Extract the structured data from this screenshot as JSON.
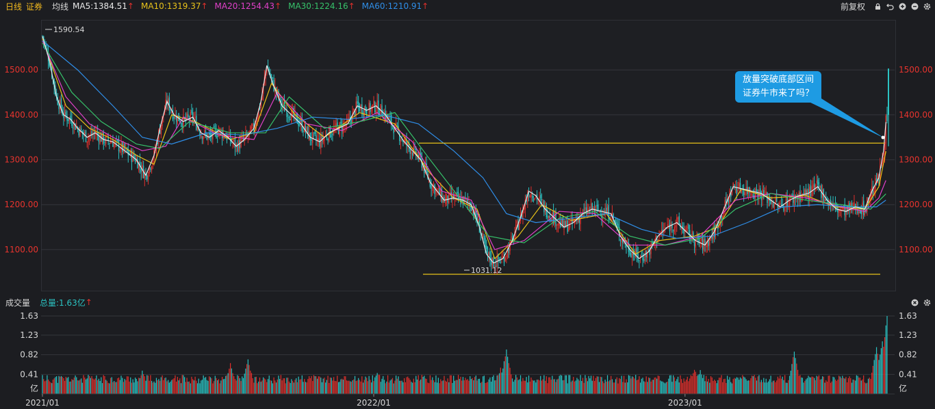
{
  "header": {
    "period": "日线",
    "name": "证券",
    "ma_label": "均线",
    "ma": [
      {
        "text": "MA5:1384.51",
        "color": "#e8e8e8"
      },
      {
        "text": "MA10:1319.37",
        "color": "#e8c21a"
      },
      {
        "text": "MA20:1254.43",
        "color": "#e040c8"
      },
      {
        "text": "MA30:1224.16",
        "color": "#36c26a"
      },
      {
        "text": "MA60:1210.91",
        "color": "#2f8ee8"
      }
    ],
    "adjust_label": "前复权",
    "up_arrow": "↑"
  },
  "callout": {
    "line1": "放量突破底部区间",
    "line2": "证券牛市来了吗？"
  },
  "volume_header": {
    "title": "成交量",
    "total": "总量:1.63亿"
  },
  "colors": {
    "up": "#e0302c",
    "down": "#2bc3c3",
    "label_red": "#e8342e",
    "support": "#e8c21a"
  },
  "chart_data": [
    {
      "type": "candlestick",
      "title": "证券",
      "y_ticks": [
        "1500.00",
        "1400.00",
        "1300.00",
        "1200.00",
        "1100.00"
      ],
      "ylim": [
        1010,
        1610
      ],
      "annotations": {
        "high": "1590.54",
        "low": "1031.12"
      },
      "support_lines": [
        1337,
        1045
      ],
      "close_path": [
        [
          0,
          1575
        ],
        [
          6,
          1520
        ],
        [
          12,
          1440
        ],
        [
          18,
          1400
        ],
        [
          24,
          1390
        ],
        [
          30,
          1370
        ],
        [
          38,
          1350
        ],
        [
          45,
          1360
        ],
        [
          52,
          1345
        ],
        [
          60,
          1340
        ],
        [
          70,
          1320
        ],
        [
          80,
          1300
        ],
        [
          88,
          1265
        ],
        [
          95,
          1310
        ],
        [
          100,
          1370
        ],
        [
          106,
          1430
        ],
        [
          112,
          1400
        ],
        [
          120,
          1385
        ],
        [
          128,
          1395
        ],
        [
          135,
          1360
        ],
        [
          142,
          1350
        ],
        [
          150,
          1365
        ],
        [
          158,
          1350
        ],
        [
          165,
          1330
        ],
        [
          172,
          1345
        ],
        [
          180,
          1370
        ],
        [
          186,
          1430
        ],
        [
          191,
          1510
        ],
        [
          196,
          1470
        ],
        [
          204,
          1420
        ],
        [
          212,
          1400
        ],
        [
          220,
          1380
        ],
        [
          228,
          1350
        ],
        [
          236,
          1340
        ],
        [
          244,
          1360
        ],
        [
          252,
          1370
        ],
        [
          260,
          1380
        ],
        [
          268,
          1420
        ],
        [
          276,
          1410
        ],
        [
          284,
          1420
        ],
        [
          292,
          1400
        ],
        [
          300,
          1370
        ],
        [
          308,
          1340
        ],
        [
          315,
          1320
        ],
        [
          322,
          1300
        ],
        [
          330,
          1250
        ],
        [
          336,
          1230
        ],
        [
          342,
          1210
        ],
        [
          350,
          1215
        ],
        [
          358,
          1210
        ],
        [
          365,
          1200
        ],
        [
          372,
          1150
        ],
        [
          378,
          1090
        ],
        [
          384,
          1070
        ],
        [
          392,
          1080
        ],
        [
          400,
          1120
        ],
        [
          408,
          1180
        ],
        [
          414,
          1230
        ],
        [
          420,
          1220
        ],
        [
          428,
          1190
        ],
        [
          436,
          1170
        ],
        [
          444,
          1150
        ],
        [
          452,
          1160
        ],
        [
          460,
          1180
        ],
        [
          468,
          1190
        ],
        [
          476,
          1185
        ],
        [
          484,
          1180
        ],
        [
          492,
          1130
        ],
        [
          500,
          1100
        ],
        [
          508,
          1080
        ],
        [
          516,
          1095
        ],
        [
          524,
          1130
        ],
        [
          532,
          1150
        ],
        [
          540,
          1160
        ],
        [
          548,
          1140
        ],
        [
          556,
          1120
        ],
        [
          564,
          1110
        ],
        [
          572,
          1140
        ],
        [
          580,
          1190
        ],
        [
          588,
          1240
        ],
        [
          596,
          1235
        ],
        [
          604,
          1230
        ],
        [
          612,
          1225
        ],
        [
          620,
          1210
        ],
        [
          628,
          1195
        ],
        [
          636,
          1210
        ],
        [
          644,
          1220
        ],
        [
          652,
          1225
        ],
        [
          660,
          1240
        ],
        [
          668,
          1210
        ],
        [
          676,
          1190
        ],
        [
          684,
          1185
        ],
        [
          692,
          1195
        ],
        [
          700,
          1190
        ],
        [
          706,
          1230
        ],
        [
          712,
          1260
        ],
        [
          716,
          1320
        ],
        [
          718,
          1384
        ]
      ],
      "ma_paths": {
        "ma10": [
          [
            0,
            1570
          ],
          [
            20,
            1420
          ],
          [
            40,
            1370
          ],
          [
            60,
            1345
          ],
          [
            80,
            1310
          ],
          [
            95,
            1290
          ],
          [
            110,
            1400
          ],
          [
            130,
            1385
          ],
          [
            160,
            1345
          ],
          [
            180,
            1360
          ],
          [
            195,
            1470
          ],
          [
            215,
            1400
          ],
          [
            240,
            1350
          ],
          [
            270,
            1405
          ],
          [
            300,
            1380
          ],
          [
            330,
            1270
          ],
          [
            350,
            1215
          ],
          [
            370,
            1190
          ],
          [
            385,
            1080
          ],
          [
            405,
            1130
          ],
          [
            425,
            1200
          ],
          [
            450,
            1165
          ],
          [
            480,
            1180
          ],
          [
            505,
            1090
          ],
          [
            525,
            1120
          ],
          [
            555,
            1130
          ],
          [
            575,
            1150
          ],
          [
            595,
            1235
          ],
          [
            620,
            1215
          ],
          [
            650,
            1220
          ],
          [
            675,
            1195
          ],
          [
            700,
            1190
          ],
          [
            712,
            1240
          ],
          [
            718,
            1319
          ]
        ],
        "ma20": [
          [
            0,
            1565
          ],
          [
            20,
            1440
          ],
          [
            40,
            1380
          ],
          [
            60,
            1350
          ],
          [
            85,
            1320
          ],
          [
            105,
            1330
          ],
          [
            120,
            1395
          ],
          [
            150,
            1355
          ],
          [
            180,
            1345
          ],
          [
            200,
            1450
          ],
          [
            225,
            1380
          ],
          [
            255,
            1365
          ],
          [
            285,
            1405
          ],
          [
            315,
            1340
          ],
          [
            340,
            1230
          ],
          [
            365,
            1210
          ],
          [
            385,
            1100
          ],
          [
            410,
            1120
          ],
          [
            440,
            1185
          ],
          [
            470,
            1180
          ],
          [
            500,
            1110
          ],
          [
            530,
            1110
          ],
          [
            560,
            1130
          ],
          [
            590,
            1210
          ],
          [
            620,
            1225
          ],
          [
            650,
            1215
          ],
          [
            680,
            1195
          ],
          [
            700,
            1185
          ],
          [
            712,
            1215
          ],
          [
            718,
            1254
          ]
        ],
        "ma30": [
          [
            0,
            1560
          ],
          [
            25,
            1450
          ],
          [
            50,
            1385
          ],
          [
            80,
            1335
          ],
          [
            100,
            1325
          ],
          [
            125,
            1385
          ],
          [
            160,
            1360
          ],
          [
            190,
            1360
          ],
          [
            210,
            1440
          ],
          [
            240,
            1370
          ],
          [
            270,
            1385
          ],
          [
            300,
            1405
          ],
          [
            330,
            1300
          ],
          [
            355,
            1215
          ],
          [
            380,
            1130
          ],
          [
            410,
            1115
          ],
          [
            440,
            1170
          ],
          [
            470,
            1185
          ],
          [
            500,
            1130
          ],
          [
            530,
            1110
          ],
          [
            560,
            1125
          ],
          [
            590,
            1190
          ],
          [
            620,
            1225
          ],
          [
            650,
            1210
          ],
          [
            680,
            1200
          ],
          [
            705,
            1190
          ],
          [
            718,
            1224
          ]
        ],
        "ma60": [
          [
            0,
            1565
          ],
          [
            30,
            1500
          ],
          [
            60,
            1420
          ],
          [
            85,
            1350
          ],
          [
            110,
            1335
          ],
          [
            140,
            1360
          ],
          [
            170,
            1355
          ],
          [
            200,
            1370
          ],
          [
            230,
            1395
          ],
          [
            260,
            1390
          ],
          [
            290,
            1400
          ],
          [
            320,
            1380
          ],
          [
            350,
            1320
          ],
          [
            375,
            1260
          ],
          [
            395,
            1180
          ],
          [
            420,
            1160
          ],
          [
            450,
            1170
          ],
          [
            480,
            1180
          ],
          [
            510,
            1145
          ],
          [
            540,
            1125
          ],
          [
            570,
            1130
          ],
          [
            600,
            1160
          ],
          [
            630,
            1195
          ],
          [
            660,
            1200
          ],
          [
            690,
            1195
          ],
          [
            710,
            1195
          ],
          [
            718,
            1210
          ]
        ]
      }
    },
    {
      "type": "bar",
      "title": "成交量",
      "y_ticks": [
        "1.63",
        "1.23",
        "0.82",
        "0.41"
      ],
      "unit": "亿",
      "ylim": [
        0,
        1.63
      ],
      "x_ticks": [
        "2021/01",
        "2022/01",
        "2023/01"
      ],
      "peaks": [
        [
          0,
          0.35
        ],
        [
          85,
          0.45
        ],
        [
          160,
          0.6
        ],
        [
          175,
          0.68
        ],
        [
          285,
          0.42
        ],
        [
          390,
          0.5
        ],
        [
          395,
          0.9
        ],
        [
          560,
          0.45
        ],
        [
          555,
          0.5
        ],
        [
          640,
          0.85
        ],
        [
          710,
          0.95
        ],
        [
          715,
          1.1
        ],
        [
          719,
          1.63
        ]
      ]
    }
  ]
}
